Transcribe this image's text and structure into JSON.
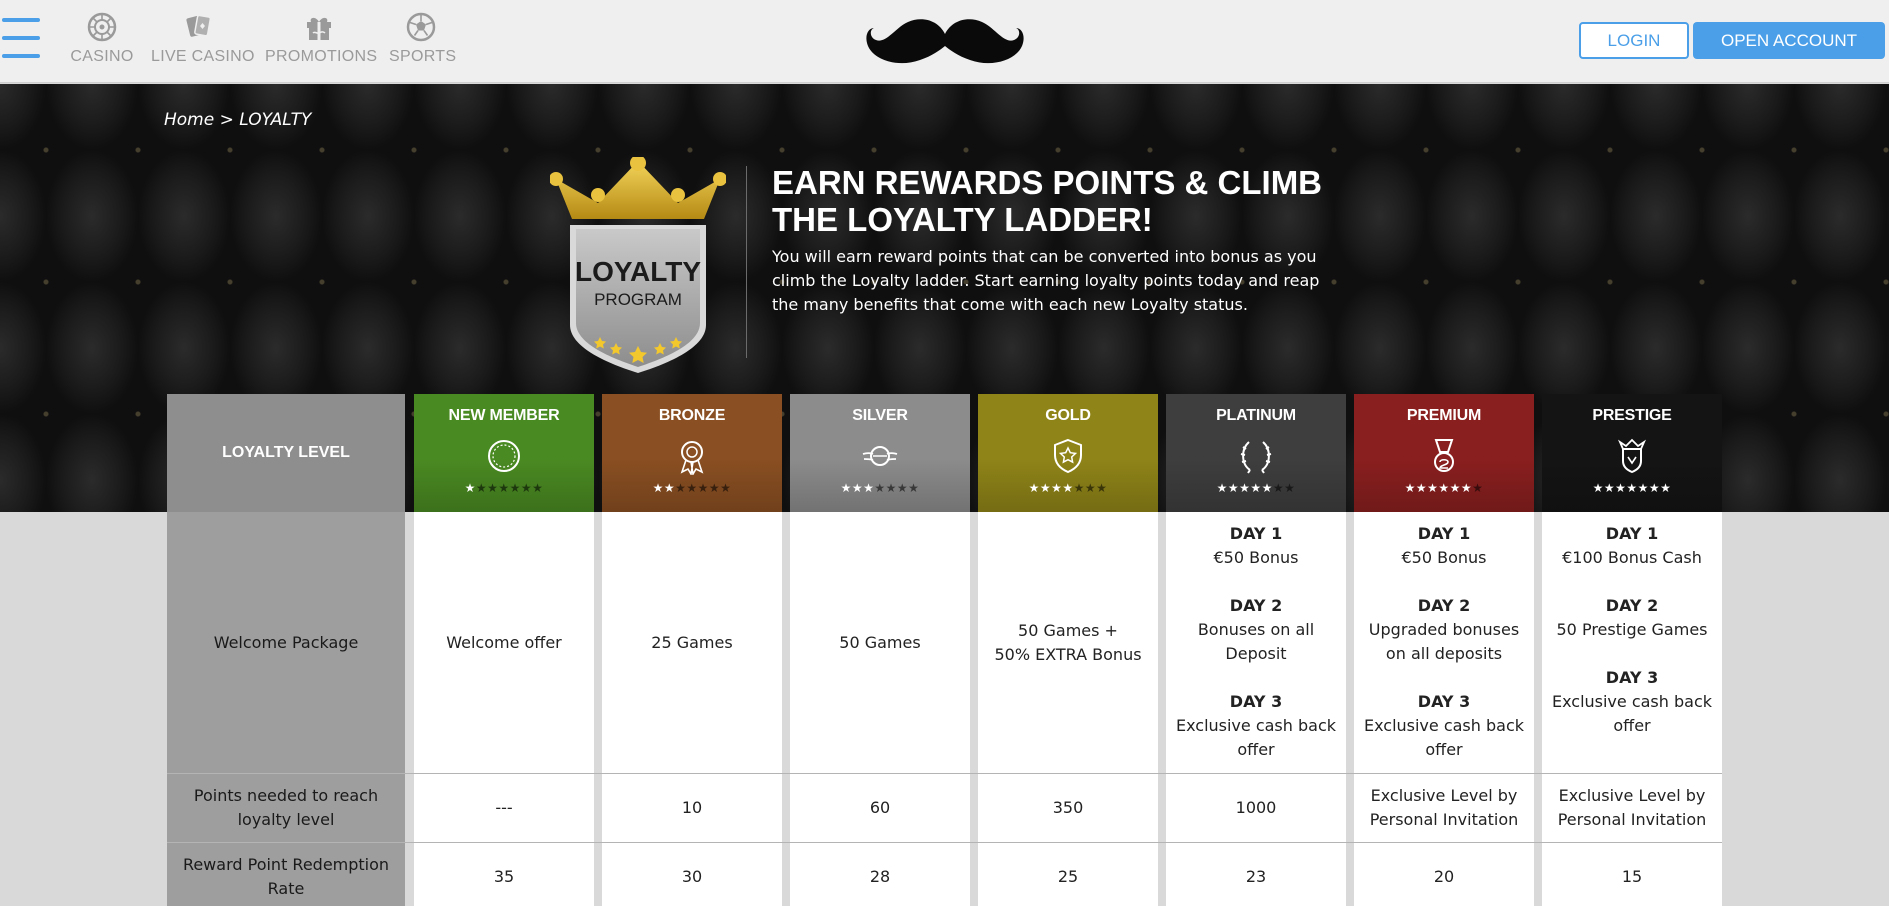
{
  "header": {
    "nav": [
      {
        "label": "CASINO",
        "icon": "roulette-icon"
      },
      {
        "label": "LIVE CASINO",
        "icon": "cards-icon"
      },
      {
        "label": "PROMOTIONS",
        "icon": "gift-icon"
      },
      {
        "label": "SPORTS",
        "icon": "soccer-ball-icon"
      }
    ],
    "logo": "mustache-logo",
    "login_label": "LOGIN",
    "open_account_label": "OPEN ACCOUNT",
    "accent": "#4a9fe8"
  },
  "breadcrumb": {
    "home": "Home",
    "separator": ">",
    "current": "LOYALTY"
  },
  "badge": {
    "line1": "LOYALTY",
    "line2": "PROGRAM"
  },
  "hero": {
    "title_line1": "EARN REWARDS POINTS & CLIMB",
    "title_line2": "THE LOYALTY LADDER!",
    "text": "You will earn reward points that can be converted into bonus as you climb the Loyalty ladder. Start earning loyalty points today and reap the many benefits that come with each new Loyalty status."
  },
  "table": {
    "level_header": "LOYALTY LEVEL",
    "row_labels": {
      "welcome": "Welcome Package",
      "points": "Points needed to reach loyalty level",
      "redemption": "Reward Point Redemption Rate"
    },
    "levels": [
      {
        "name": "NEW MEMBER",
        "color": "#4a8a22",
        "icon": "ring-icon",
        "stars_filled": 1,
        "stars_total": 7,
        "welcome": [
          "Welcome offer"
        ],
        "points": "---",
        "redemption": "35"
      },
      {
        "name": "BRONZE",
        "color": "#8a4f22",
        "icon": "rosette-icon",
        "stars_filled": 2,
        "stars_total": 7,
        "welcome": [
          "25 Games"
        ],
        "points": "10",
        "redemption": "30"
      },
      {
        "name": "SILVER",
        "color": "#8c8c8c",
        "icon": "winged-emblem-icon",
        "stars_filled": 3,
        "stars_total": 7,
        "welcome": [
          "50 Games"
        ],
        "points": "60",
        "redemption": "28"
      },
      {
        "name": "GOLD",
        "color": "#8f8418",
        "icon": "shield-star-icon",
        "stars_filled": 4,
        "stars_total": 7,
        "welcome": [
          "50 Games +",
          "50% EXTRA Bonus"
        ],
        "points": "350",
        "redemption": "25"
      },
      {
        "name": "PLATINUM",
        "color": "#3e3e3e",
        "icon": "laurel-wreath-icon",
        "stars_filled": 5,
        "stars_total": 7,
        "welcome_days": [
          {
            "day": "DAY 1",
            "lines": [
              "€50 Bonus"
            ]
          },
          {
            "day": "DAY 2",
            "lines": [
              "Bonuses on all",
              "Deposit"
            ]
          },
          {
            "day": "DAY 3",
            "lines": [
              "Exclusive cash back",
              "offer"
            ]
          }
        ],
        "points": "1000",
        "redemption": "23"
      },
      {
        "name": "PREMIUM",
        "color": "#8a1f1f",
        "icon": "medal-icon",
        "stars_filled": 6,
        "stars_total": 7,
        "welcome_days": [
          {
            "day": "DAY 1",
            "lines": [
              "€50 Bonus"
            ]
          },
          {
            "day": "DAY 2",
            "lines": [
              "Upgraded bonuses",
              "on all deposits"
            ]
          },
          {
            "day": "DAY 3",
            "lines": [
              "Exclusive cash back",
              "offer"
            ]
          }
        ],
        "points": "Exclusive Level by Personal Invitation",
        "redemption": "20"
      },
      {
        "name": "PRESTIGE",
        "color": "#141414",
        "icon": "crest-icon",
        "stars_filled": 7,
        "stars_total": 7,
        "welcome_days": [
          {
            "day": "DAY 1",
            "lines": [
              "€100 Bonus Cash"
            ]
          },
          {
            "day": "DAY 2",
            "lines": [
              "50 Prestige Games"
            ]
          },
          {
            "day": "DAY 3",
            "lines": [
              "Exclusive cash back",
              "offer"
            ]
          }
        ],
        "points": "Exclusive Level by Personal Invitation",
        "redemption": "15"
      }
    ]
  }
}
